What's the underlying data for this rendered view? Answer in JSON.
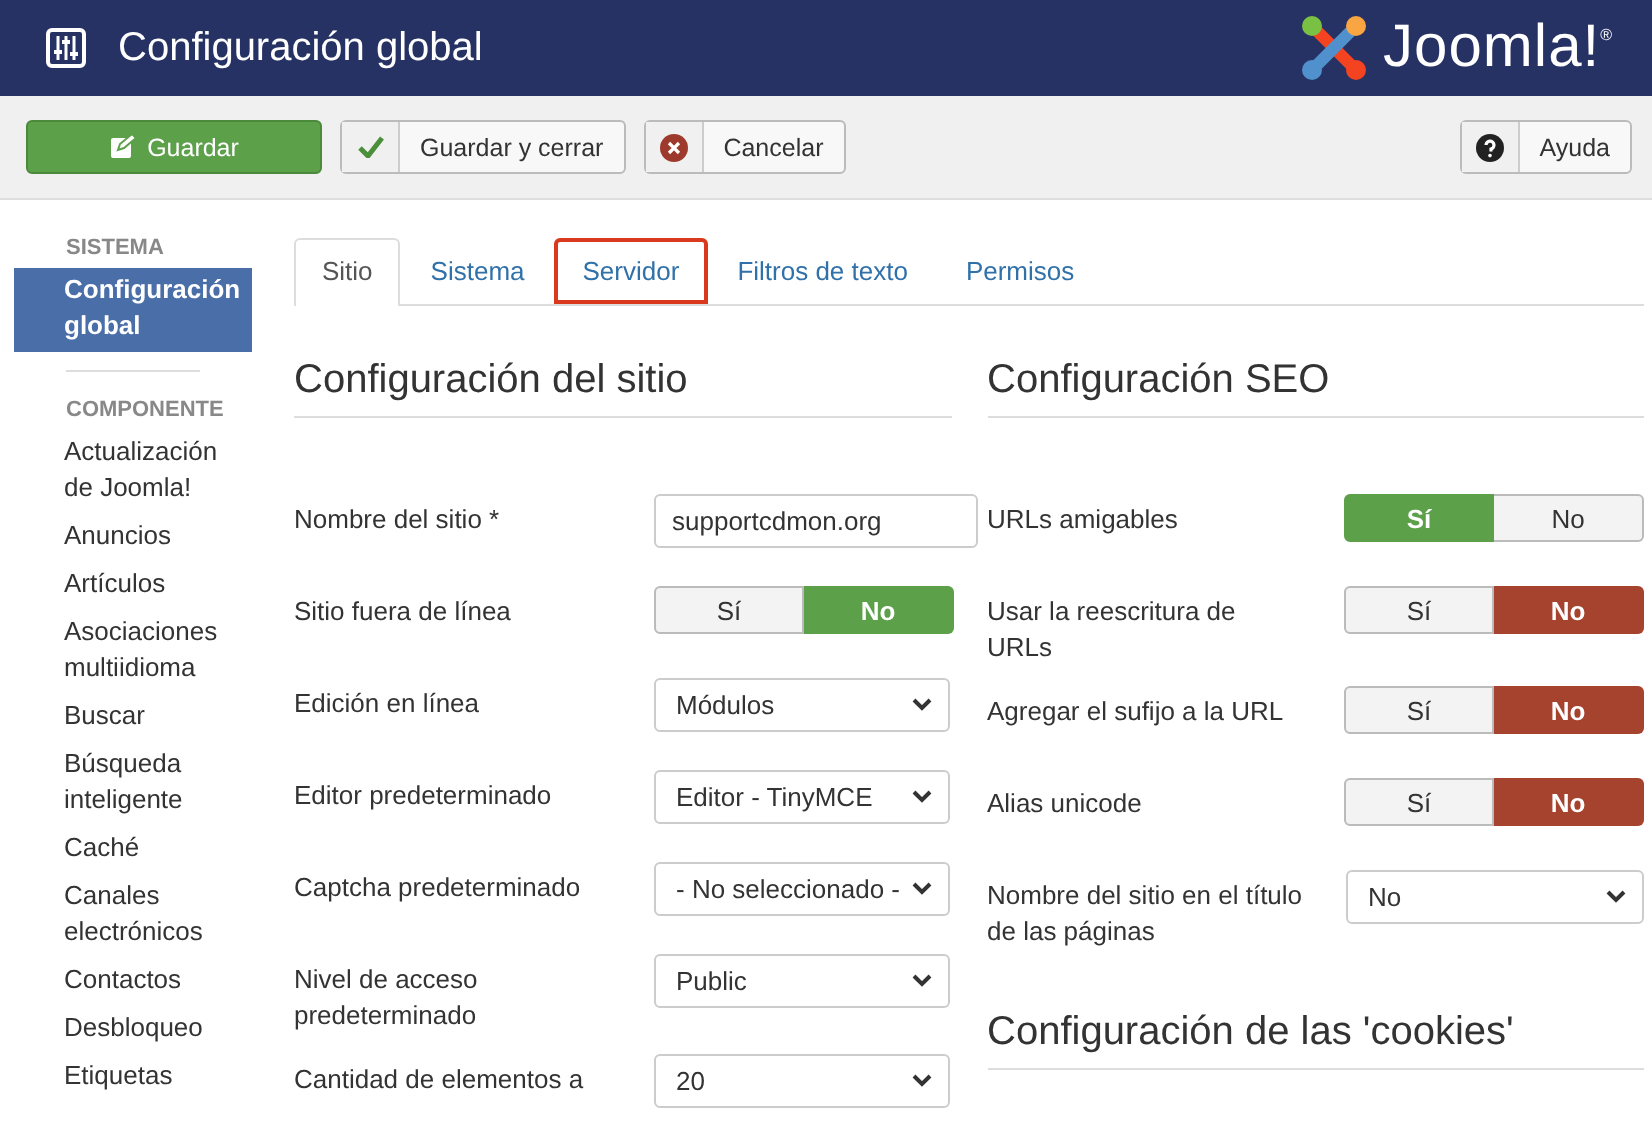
{
  "header": {
    "title": "Configuración global",
    "logo_text": "Joomla!",
    "logo_mark": "®"
  },
  "toolbar": {
    "buttons": [
      {
        "label": "Guardar",
        "kind": "primary"
      },
      {
        "label": "Guardar y cerrar",
        "kind": "check"
      },
      {
        "label": "Cancelar",
        "kind": "cancel"
      }
    ],
    "help": {
      "label": "Ayuda"
    }
  },
  "sidebar": {
    "sections": [
      {
        "heading": "SISTEMA",
        "items": [
          {
            "label": "Configuración global",
            "selected": true
          }
        ]
      },
      {
        "heading": "COMPONENTE",
        "items": [
          {
            "label": "Actualización de Joomla!",
            "selected": false
          },
          {
            "label": "Anuncios",
            "selected": false
          },
          {
            "label": "Artículos",
            "selected": false
          },
          {
            "label": "Asociaciones multiidioma",
            "selected": false
          },
          {
            "label": "Buscar",
            "selected": false
          },
          {
            "label": "Búsqueda inteligente",
            "selected": false
          },
          {
            "label": "Caché",
            "selected": false
          },
          {
            "label": "Canales electrónicos",
            "selected": false
          },
          {
            "label": "Contactos",
            "selected": false
          },
          {
            "label": "Desbloqueo",
            "selected": false
          },
          {
            "label": "Etiquetas",
            "selected": false
          }
        ]
      }
    ]
  },
  "tabs": [
    {
      "label": "Sitio",
      "selected": true,
      "highlighted": false
    },
    {
      "label": "Sistema",
      "selected": false,
      "highlighted": false
    },
    {
      "label": "Servidor",
      "selected": false,
      "highlighted": true
    },
    {
      "label": "Filtros de texto",
      "selected": false,
      "highlighted": false
    },
    {
      "label": "Permisos",
      "selected": false,
      "highlighted": false
    }
  ],
  "columns": [
    {
      "heading": "Configuración del sitio",
      "fields": [
        {
          "label": "Nombre del sitio *",
          "kind": "text",
          "value": "supportcdmon.org"
        },
        {
          "label": "Sitio fuera de línea",
          "kind": "toggle",
          "color": "#5ca04a",
          "options": [
            {
              "label": "Sí",
              "selected": false
            },
            {
              "label": "No",
              "selected": true
            }
          ]
        },
        {
          "label": "Edición en línea",
          "kind": "select",
          "value": "Módulos"
        },
        {
          "label": "Editor predeterminado",
          "kind": "select",
          "value": "Editor - TinyMCE"
        },
        {
          "label": "Captcha predeterminado",
          "kind": "select",
          "value": "- No seleccionado -"
        },
        {
          "label": "Nivel de acceso predeterminado",
          "kind": "select",
          "value": "Public"
        },
        {
          "label": "Cantidad de elementos a",
          "kind": "select",
          "value": "20"
        }
      ]
    },
    {
      "heading": "Configuración SEO",
      "fields": [
        {
          "label": "URLs amigables",
          "kind": "toggle",
          "color": "#5ca04a",
          "options": [
            {
              "label": "Sí",
              "selected": true
            },
            {
              "label": "No",
              "selected": false
            }
          ]
        },
        {
          "label": "Usar la reescritura de URLs",
          "kind": "toggle",
          "color": "#a6432f",
          "options": [
            {
              "label": "Sí",
              "selected": false
            },
            {
              "label": "No",
              "selected": true
            }
          ]
        },
        {
          "label": "Agregar el sufijo a la URL",
          "kind": "toggle",
          "color": "#a6432f",
          "options": [
            {
              "label": "Sí",
              "selected": false
            },
            {
              "label": "No",
              "selected": true
            }
          ]
        },
        {
          "label": "Alias unicode",
          "kind": "toggle",
          "color": "#a6432f",
          "options": [
            {
              "label": "Sí",
              "selected": false
            },
            {
              "label": "No",
              "selected": true
            }
          ]
        },
        {
          "label": "Nombre del sitio en el título de las páginas",
          "kind": "select",
          "value": "No"
        }
      ],
      "subheading": "Configuración de las 'cookies'"
    }
  ]
}
